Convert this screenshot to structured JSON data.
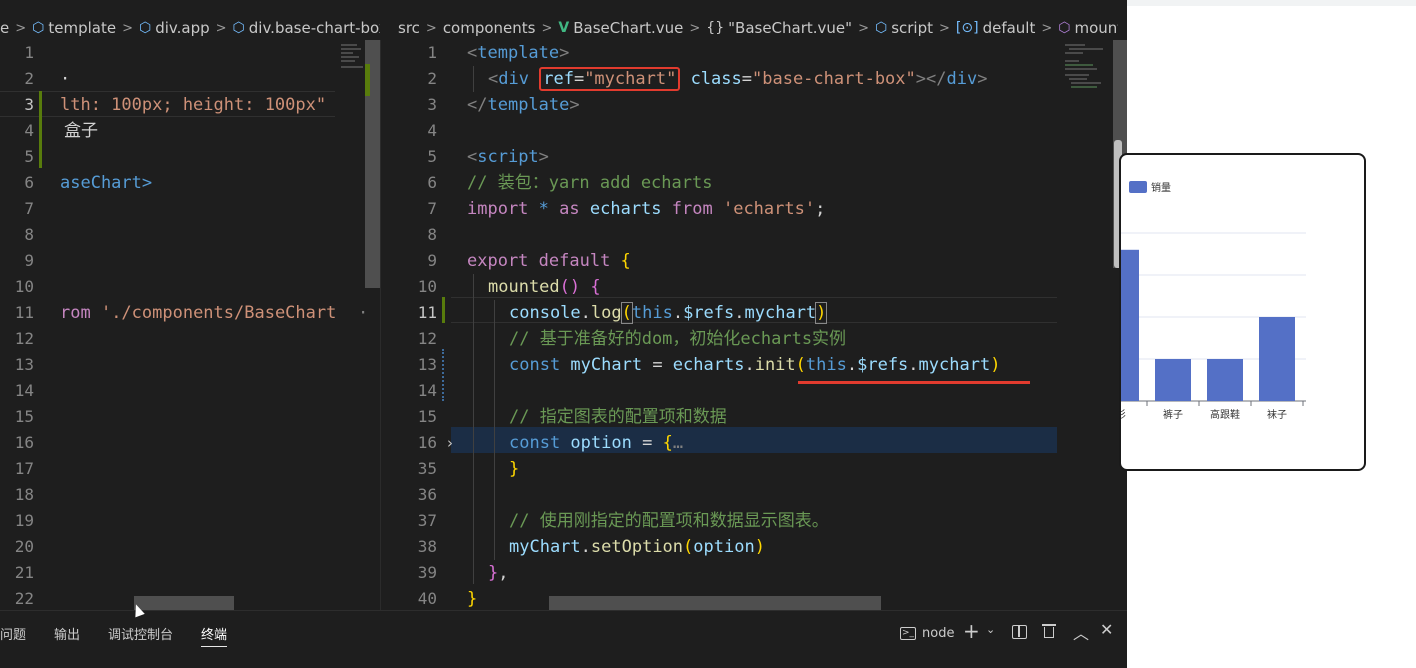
{
  "left_breadcrumb": [
    {
      "icon": "none",
      "label": "e"
    },
    {
      "icon": "cube-icon",
      "label": "template"
    },
    {
      "icon": "cube-icon",
      "label": "div.app"
    },
    {
      "icon": "cube-icon",
      "label": "div.base-chart-box"
    }
  ],
  "right_breadcrumb": [
    {
      "icon": "none",
      "label": "src"
    },
    {
      "icon": "none",
      "label": "components"
    },
    {
      "icon": "vue-icon",
      "label": "BaseChart.vue"
    },
    {
      "icon": "braces-icon",
      "label": "\"BaseChart.vue\""
    },
    {
      "icon": "cube-icon",
      "label": "script"
    },
    {
      "icon": "ref-icon",
      "label": "default"
    },
    {
      "icon": "method-icon",
      "label": "mounted"
    }
  ],
  "left_editor": {
    "line_numbers": [
      "1",
      "2",
      "3",
      "4",
      "5",
      "6",
      "7",
      "8",
      "9",
      "10",
      "11",
      "12",
      "13",
      "14",
      "15",
      "16",
      "17",
      "18",
      "19",
      "20",
      "21",
      "22"
    ],
    "active_line": "3",
    "lines": {
      "l2": "·",
      "l3": "lth: 100px; height: 100px\"",
      "l4": "盒子",
      "l6": "aseChart>",
      "l11a": "rom ",
      "l11b": "'./components/BaseChart",
      "l11c": "·"
    }
  },
  "right_editor": {
    "line_numbers": [
      "1",
      "2",
      "3",
      "4",
      "5",
      "6",
      "7",
      "8",
      "9",
      "10",
      "11",
      "12",
      "13",
      "14",
      "15",
      "16",
      "35",
      "36",
      "37",
      "38",
      "39",
      "40"
    ],
    "active_line": "11",
    "code": {
      "l1_tag": "template",
      "l2_tag": "div",
      "l2_ref_attr": "ref",
      "l2_ref_val": "\"mychart\"",
      "l2_class_attr": "class",
      "l2_class_val": "\"base-chart-box\"",
      "l3_tag": "template",
      "l5_tag": "script",
      "l6_comment": "// 装包：yarn add echarts",
      "l7_import": "import",
      "l7_star": "* ",
      "l7_as": "as",
      "l7_name": " echarts ",
      "l7_from": "from",
      "l7_src": "'echarts'",
      "l7_semi": ";",
      "l9_export": "export",
      "l9_default": " default ",
      "l10_mounted": "mounted",
      "l11_console": "console",
      "l11_log": "log",
      "l11_this": "this",
      "l11_refs": "$refs",
      "l11_mychart": "mychart",
      "l12_comment": "// 基于准备好的dom，初始化echarts实例",
      "l13_const": "const",
      "l13_var": " myChart ",
      "l13_echarts": "echarts",
      "l13_init": "init",
      "l13_this": "this",
      "l13_refs": "$refs",
      "l13_mychart": "mychart",
      "l15_comment": "// 指定图表的配置项和数据",
      "l16_const": "const",
      "l16_var": " option ",
      "l16_fold": "…",
      "l37_comment": "// 使用刚指定的配置项和数据显示图表。",
      "l38_obj": "myChart",
      "l38_fn": "setOption",
      "l38_arg": "option"
    }
  },
  "panel": {
    "tabs": [
      "问题",
      "输出",
      "调试控制台",
      "终端"
    ],
    "active_tab": "终端",
    "terminal_name": "node"
  },
  "chart_data": {
    "type": "bar",
    "legend": "销量",
    "categories": [
      "衫",
      "裤子",
      "高跟鞋",
      "袜子"
    ],
    "values": [
      36,
      10,
      10,
      20
    ],
    "ylim": [
      0,
      40
    ],
    "color": "#5470c6"
  }
}
